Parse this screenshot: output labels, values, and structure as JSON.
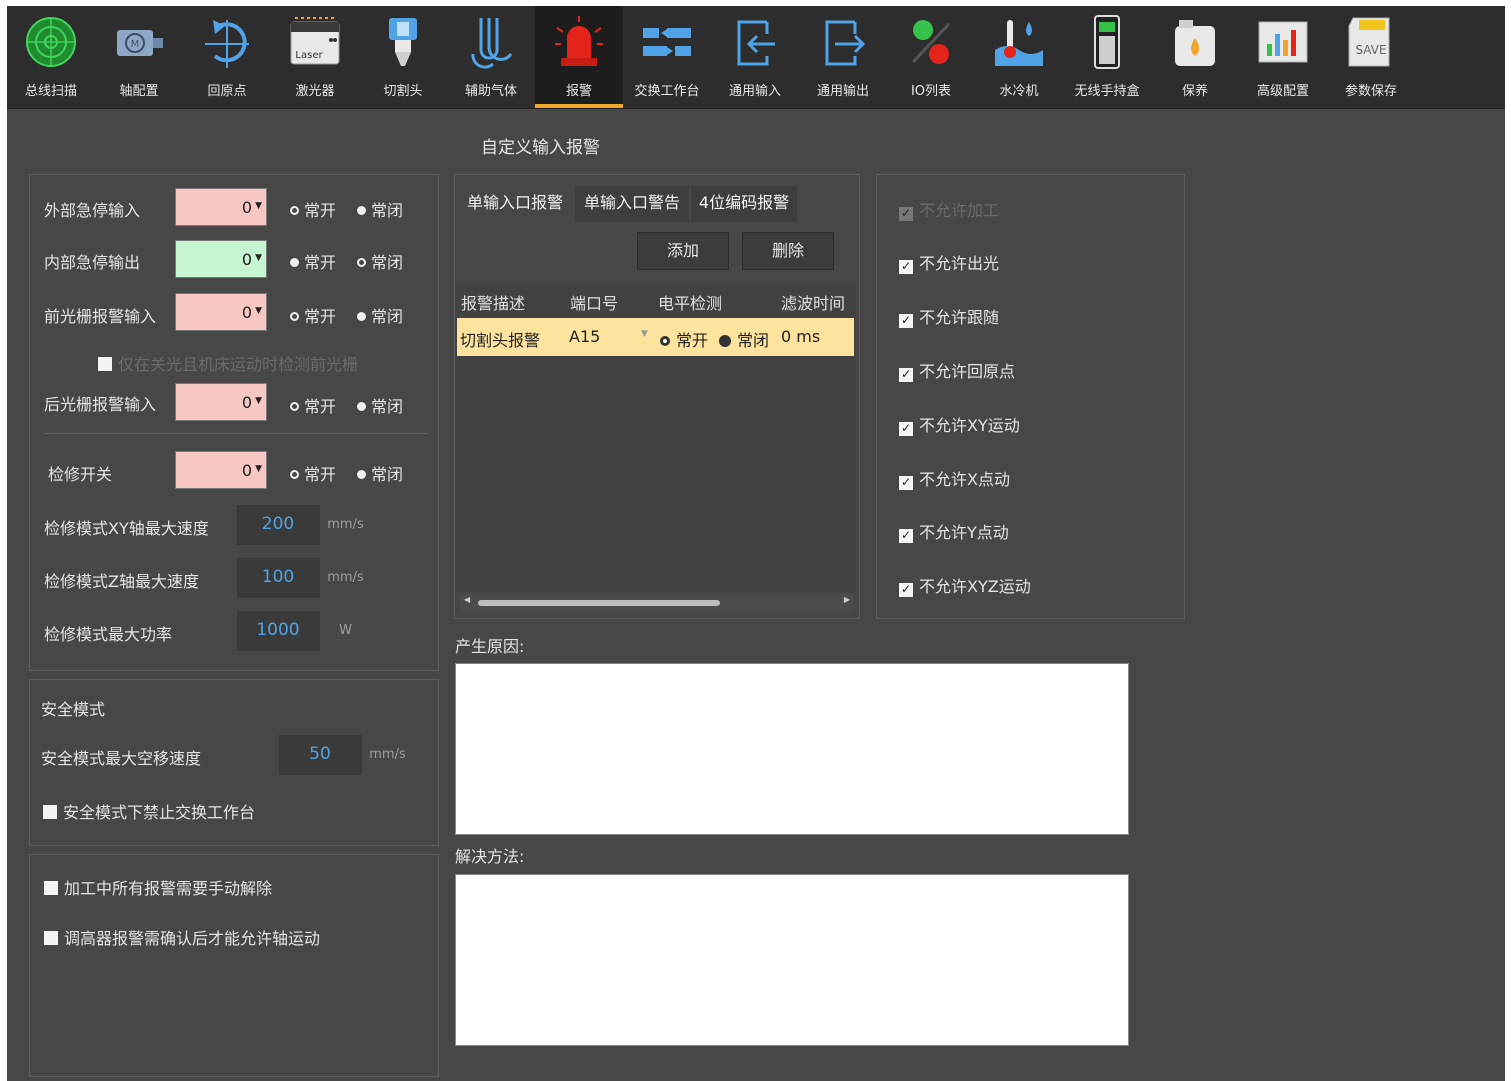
{
  "toolbar": {
    "items": [
      {
        "label": "总线扫描",
        "icon": "radar-icon"
      },
      {
        "label": "轴配置",
        "icon": "motor-icon"
      },
      {
        "label": "回原点",
        "icon": "return-origin-icon"
      },
      {
        "label": "激光器",
        "icon": "laser-icon",
        "icon_text": "Laser"
      },
      {
        "label": "切割头",
        "icon": "cutting-head-icon"
      },
      {
        "label": "辅助气体",
        "icon": "gas-icon"
      },
      {
        "label": "报警",
        "icon": "alarm-icon"
      },
      {
        "label": "交换工作台",
        "icon": "exchange-table-icon"
      },
      {
        "label": "通用输入",
        "icon": "input-icon"
      },
      {
        "label": "通用输出",
        "icon": "output-icon"
      },
      {
        "label": "IO列表",
        "icon": "io-list-icon"
      },
      {
        "label": "水冷机",
        "icon": "chiller-icon"
      },
      {
        "label": "无线手持盒",
        "icon": "handheld-icon"
      },
      {
        "label": "保养",
        "icon": "maintenance-icon"
      },
      {
        "label": "高级配置",
        "icon": "advanced-config-icon"
      },
      {
        "label": "参数保存",
        "icon": "save-icon",
        "icon_text": "SAVE"
      }
    ],
    "active_index": 6,
    "active_color": "#f0a62a"
  },
  "io_panel": {
    "rows": [
      {
        "label": "外部急停输入",
        "value": "0",
        "no": "常开",
        "nc": "常闭",
        "selected": "nc",
        "color": "#f7c8c3"
      },
      {
        "label": "内部急停输出",
        "value": "0",
        "no": "常开",
        "nc": "常闭",
        "selected": "no",
        "color": "#c6f5d2"
      },
      {
        "label": "前光栅报警输入",
        "value": "0",
        "no": "常开",
        "nc": "常闭",
        "selected": "nc",
        "color": "#f7c8c3"
      },
      {
        "label": "后光栅报警输入",
        "value": "0",
        "no": "常开",
        "nc": "常闭",
        "selected": "nc",
        "color": "#f7c8c3"
      },
      {
        "label": "检修开关",
        "value": "0",
        "no": "常开",
        "nc": "常闭",
        "selected": "nc",
        "color": "#f7c8c3"
      }
    ],
    "grating_check_label": "仅在关光且机床运动时检测前光栅",
    "maint_xy": {
      "label": "检修模式XY轴最大速度",
      "value": "200",
      "unit": "mm/s"
    },
    "maint_z": {
      "label": "检修模式Z轴最大速度",
      "value": "100",
      "unit": "mm/s"
    },
    "maint_power": {
      "label": "检修模式最大功率",
      "value": "1000",
      "unit": "W"
    }
  },
  "safety_panel": {
    "title": "安全模式",
    "speed": {
      "label": "安全模式最大空移速度",
      "value": "50",
      "unit": "mm/s"
    },
    "forbid_exchange": "安全模式下禁止交换工作台"
  },
  "misc_panel": {
    "manual_release": "加工中所有报警需要手动解除",
    "height_confirm": "调高器报警需确认后才能允许轴运动"
  },
  "custom_alarm": {
    "title": "自定义输入报警",
    "tabs": [
      "单输入口报警",
      "单输入口警告",
      "4位编码报警"
    ],
    "add_label": "添加",
    "delete_label": "删除",
    "columns": [
      "报警描述",
      "端口号",
      "电平检测",
      "滤波时间"
    ],
    "rows": [
      {
        "desc": "切割头报警",
        "port": "A15",
        "no": "常开",
        "nc": "常闭",
        "level": "nc",
        "filter": "0 ms"
      }
    ],
    "cause_label": "产生原因:",
    "solution_label": "解决方法:"
  },
  "permissions": [
    {
      "label": "不允许加工",
      "checked": true,
      "disabled": true
    },
    {
      "label": "不允许出光",
      "checked": true,
      "disabled": false
    },
    {
      "label": "不允许跟随",
      "checked": true,
      "disabled": false
    },
    {
      "label": "不允许回原点",
      "checked": true,
      "disabled": false
    },
    {
      "label": "不允许XY运动",
      "checked": true,
      "disabled": false
    },
    {
      "label": "不允许X点动",
      "checked": true,
      "disabled": false
    },
    {
      "label": "不允许Y点动",
      "checked": true,
      "disabled": false
    },
    {
      "label": "不允许XYZ运动",
      "checked": true,
      "disabled": false
    }
  ]
}
